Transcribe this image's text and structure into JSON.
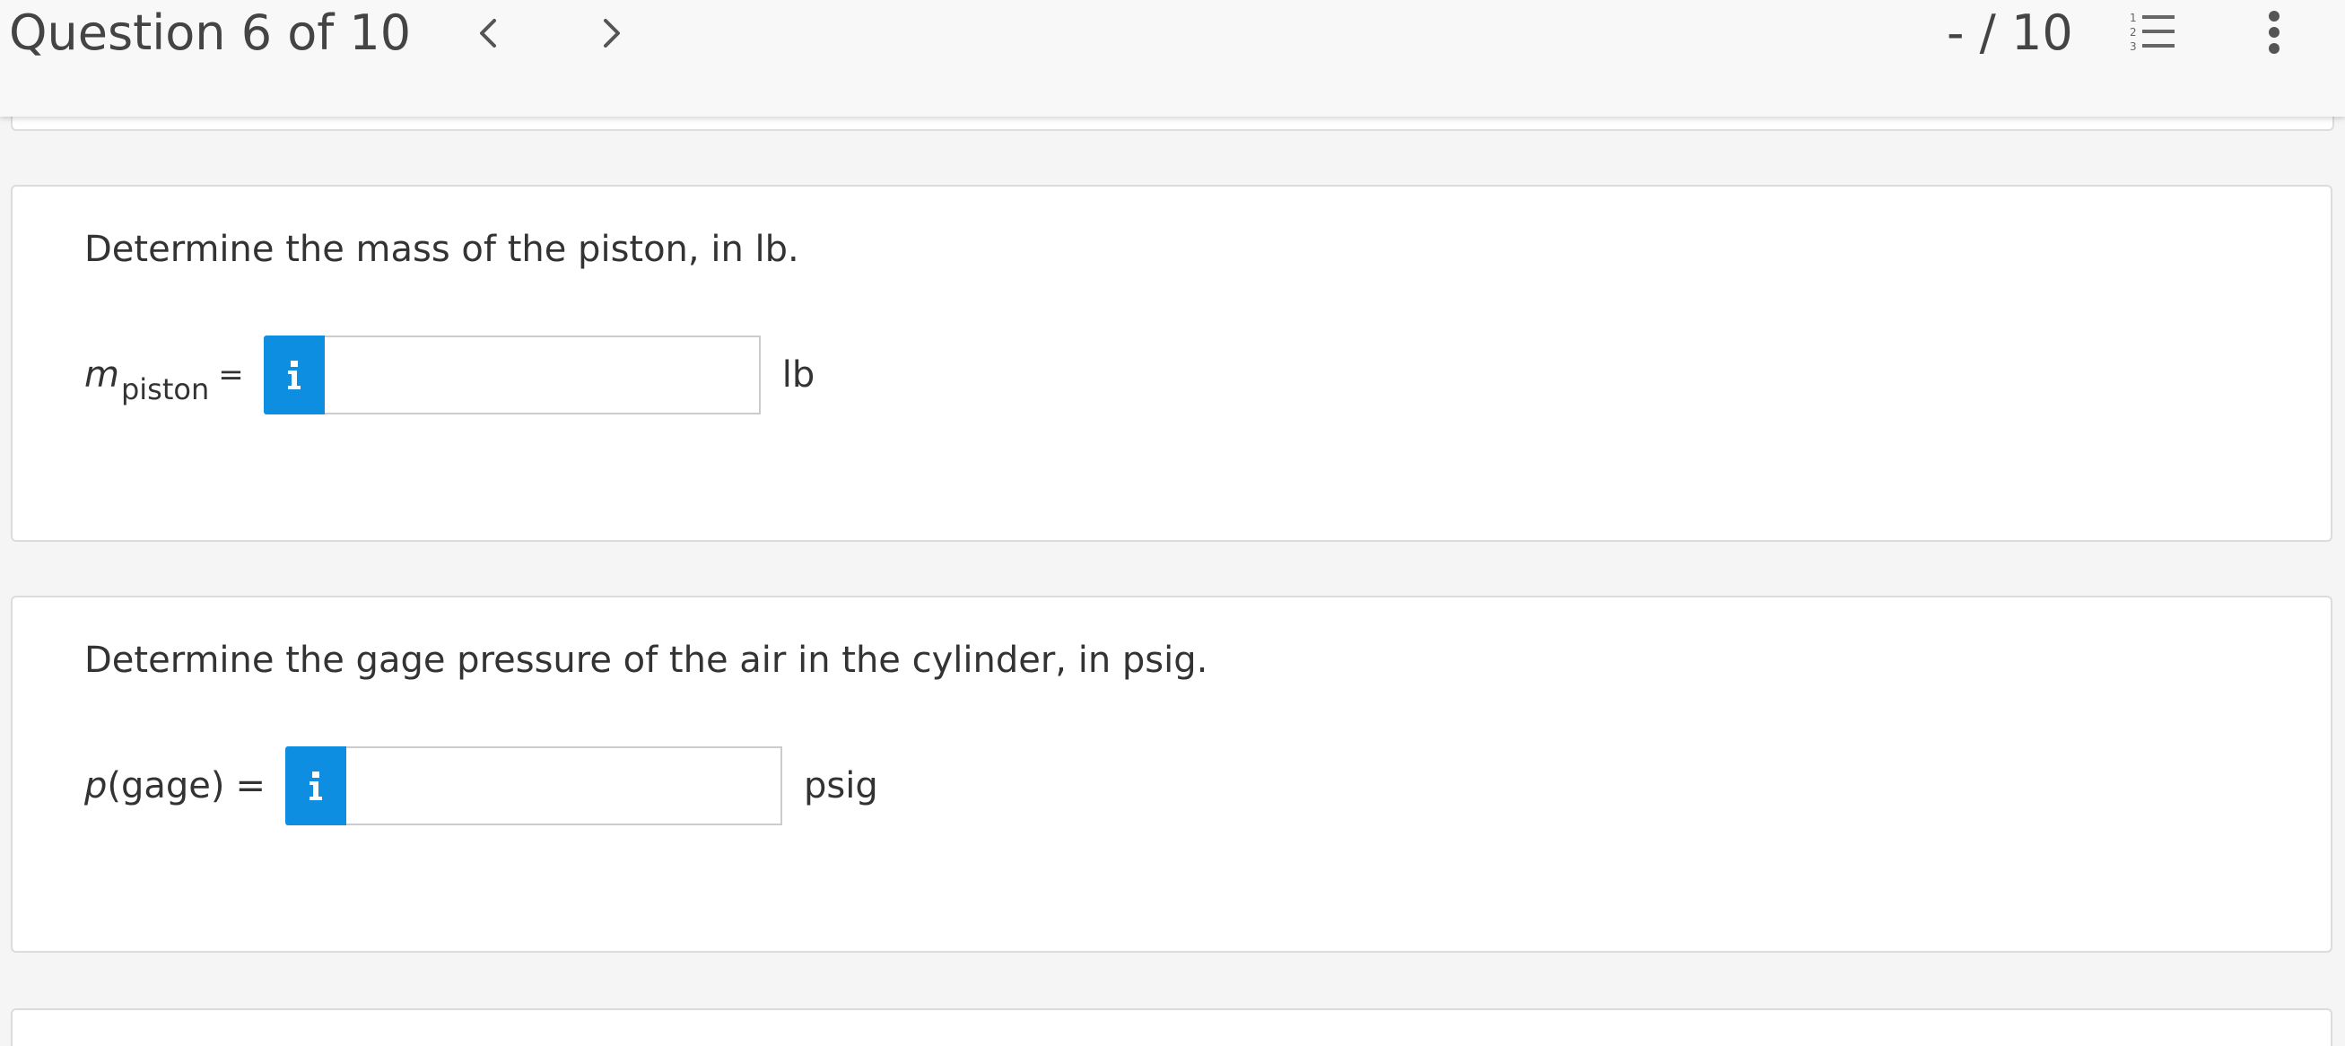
{
  "header": {
    "question_title": "Question 6 of 10",
    "score": "- / 10"
  },
  "icons": {
    "prev": "chevron-left-icon",
    "next": "chevron-right-icon",
    "list": "numbered-list-icon",
    "more": "vertical-ellipsis-icon",
    "info": "info-icon"
  },
  "colors": {
    "accent": "#0e8ee0",
    "header_bg": "#f8f8f8",
    "page_bg": "#f5f5f5"
  },
  "parts": [
    {
      "prompt": "Determine the mass of the piston, in lb.",
      "variable": "m",
      "subscript": "piston",
      "equals": "=",
      "input_value": "",
      "unit": "lb"
    },
    {
      "prompt": "Determine the gage pressure of the air in the cylinder, in psig.",
      "variable": "p",
      "suffix": "(gage)",
      "equals": "=",
      "input_value": "",
      "unit": "psig"
    }
  ]
}
